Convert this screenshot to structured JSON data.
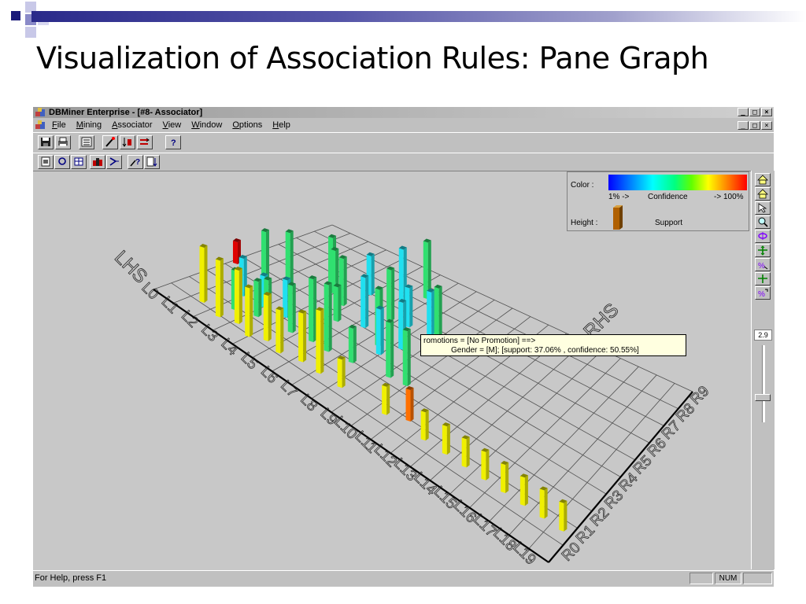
{
  "slide": {
    "title": "Visualization of Association Rules: Pane Graph"
  },
  "window": {
    "title": "DBMiner Enterprise - [#8- Associator]",
    "buttons": [
      "_",
      "□",
      "×"
    ]
  },
  "menubar": {
    "items": [
      "File",
      "Mining",
      "Associator",
      "View",
      "Window",
      "Options",
      "Help"
    ]
  },
  "legend": {
    "color_label": "Color :",
    "color_min": "1% ->",
    "color_title": "Confidence",
    "color_max": "-> 100%",
    "height_label": "Height :",
    "height_title": "Support"
  },
  "tooltip": {
    "line1": "romotions = [No Promotion] ==>",
    "line2": "Gender = [M]; [support: 37.06% , confidence: 50.55%]"
  },
  "axis": {
    "lhs_title": "LHS",
    "rhs_title": "RHS",
    "lhs_labels": [
      "L0",
      "L1",
      "L2",
      "L3",
      "L4",
      "L5",
      "L6",
      "L7",
      "L8",
      "L9",
      "L10",
      "L11",
      "L12",
      "L13",
      "L14",
      "L15",
      "L16",
      "L17",
      "L18",
      "L19"
    ],
    "rhs_labels": [
      "R0",
      "R1",
      "R2",
      "R3",
      "R4",
      "R5",
      "R6",
      "R7",
      "R8",
      "R9"
    ]
  },
  "zoom": {
    "value": "2.9",
    "level": 0.33
  },
  "statusbar": {
    "help": "For Help, press F1",
    "num": "NUM"
  }
}
